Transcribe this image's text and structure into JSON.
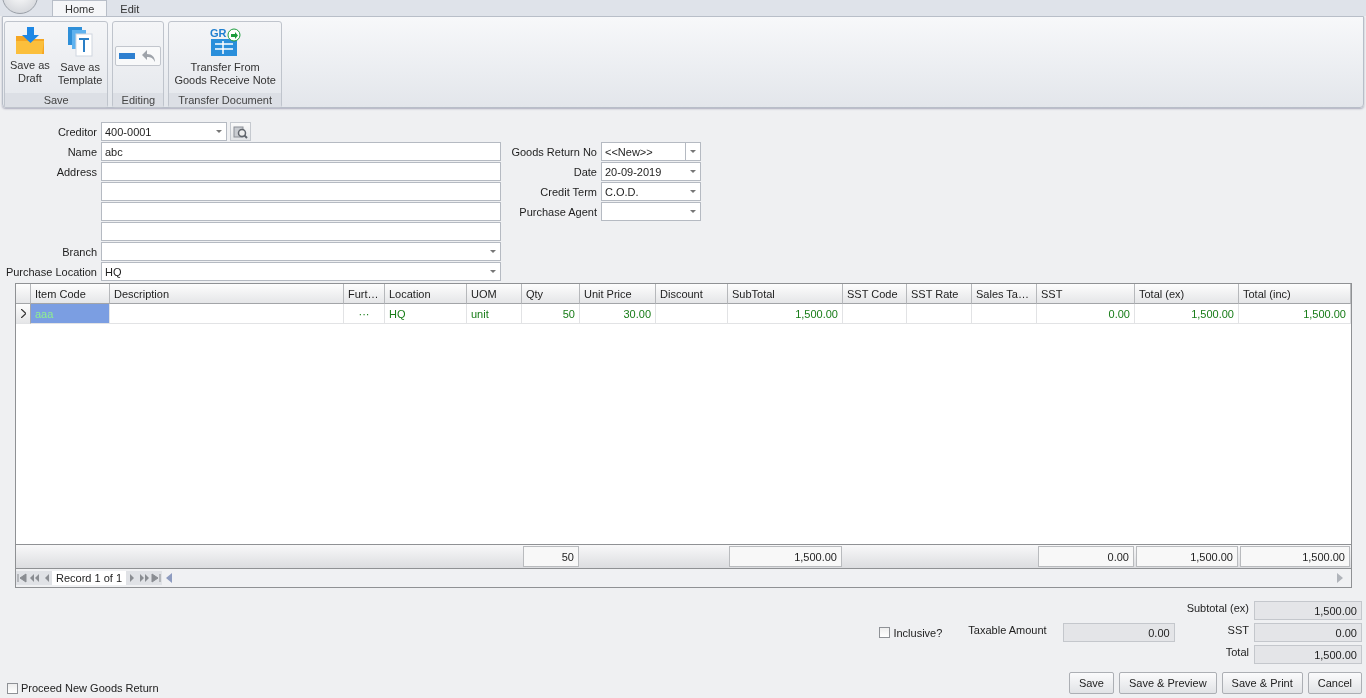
{
  "ribbon": {
    "tabs": [
      {
        "label": "Home",
        "selected": true
      },
      {
        "label": "Edit",
        "selected": false
      }
    ],
    "groups": [
      {
        "label": "Save",
        "buttons": [
          {
            "kind": "draft",
            "label": "Save as\nDraft"
          },
          {
            "kind": "template",
            "label": "Save as\nTemplate"
          }
        ]
      },
      {
        "label": "Editing",
        "buttons": [
          {
            "kind": "minus"
          },
          {
            "kind": "undo"
          }
        ]
      },
      {
        "label": "Transfer Document",
        "buttons": [
          {
            "kind": "transfer",
            "badge": "GR",
            "label": "Transfer From\nGoods Receive Note"
          }
        ]
      }
    ]
  },
  "header": {
    "left": [
      {
        "label": "Creditor",
        "value": "400-0001",
        "kind": "lookup"
      },
      {
        "label": "Name",
        "value": "abc",
        "kind": "text"
      },
      {
        "label": "Address",
        "kind": "text"
      },
      {
        "kind": "text"
      },
      {
        "kind": "text"
      },
      {
        "kind": "text"
      },
      {
        "label": "Branch",
        "kind": "combo"
      },
      {
        "label": "Purchase Location",
        "value": "HQ",
        "kind": "combo"
      }
    ],
    "right": [
      {
        "label": "Goods Return No",
        "value": "<<New>>",
        "kind": "split"
      },
      {
        "label": "Date",
        "value": "20-09-2019",
        "kind": "combo"
      },
      {
        "label": "Credit Term",
        "value": "C.O.D.",
        "kind": "combo"
      },
      {
        "label": "Purchase Agent",
        "kind": "combo"
      }
    ]
  },
  "table": {
    "columns": [
      {
        "label": "Item Code"
      },
      {
        "label": "Description"
      },
      {
        "label": "Furt…"
      },
      {
        "label": "Location"
      },
      {
        "label": "UOM"
      },
      {
        "label": "Qty",
        "total": "50"
      },
      {
        "label": "Unit Price"
      },
      {
        "label": "Discount"
      },
      {
        "label": "SubTotal",
        "total": "1,500.00"
      },
      {
        "label": "SST Code"
      },
      {
        "label": "SST Rate"
      },
      {
        "label": "Sales Ta…"
      },
      {
        "label": "SST",
        "total": "0.00"
      },
      {
        "label": "Total (ex)",
        "total": "1,500.00"
      },
      {
        "label": "Total (inc)",
        "total": "1,500.00"
      }
    ],
    "rows": [
      {
        "selected": true,
        "cells": [
          {
            "text": "aaa"
          },
          {},
          {
            "text": "···"
          },
          {
            "text": "HQ"
          },
          {
            "text": "unit"
          },
          {
            "text": "50"
          },
          {
            "text": "30.00"
          },
          {},
          {
            "text": "1,500.00"
          },
          {},
          {},
          {},
          {
            "text": "0.00"
          },
          {
            "text": "1,500.00"
          },
          {
            "text": "1,500.00"
          }
        ]
      }
    ],
    "navigator": "Record 1 of 1"
  },
  "proceed": {
    "label": "Proceed New Goods Return",
    "checked": false
  },
  "inclusive": {
    "label": "Inclusive?",
    "checked": false
  },
  "taxable": {
    "label": "Taxable Amount",
    "value": "0.00"
  },
  "summary": [
    {
      "label": "Subtotal (ex)",
      "value": "1,500.00"
    },
    {
      "label": "SST",
      "value": "0.00"
    },
    {
      "label": "Total",
      "value": "1,500.00"
    }
  ],
  "buttons": [
    "Save",
    "Save & Preview",
    "Save & Print",
    "Cancel"
  ]
}
